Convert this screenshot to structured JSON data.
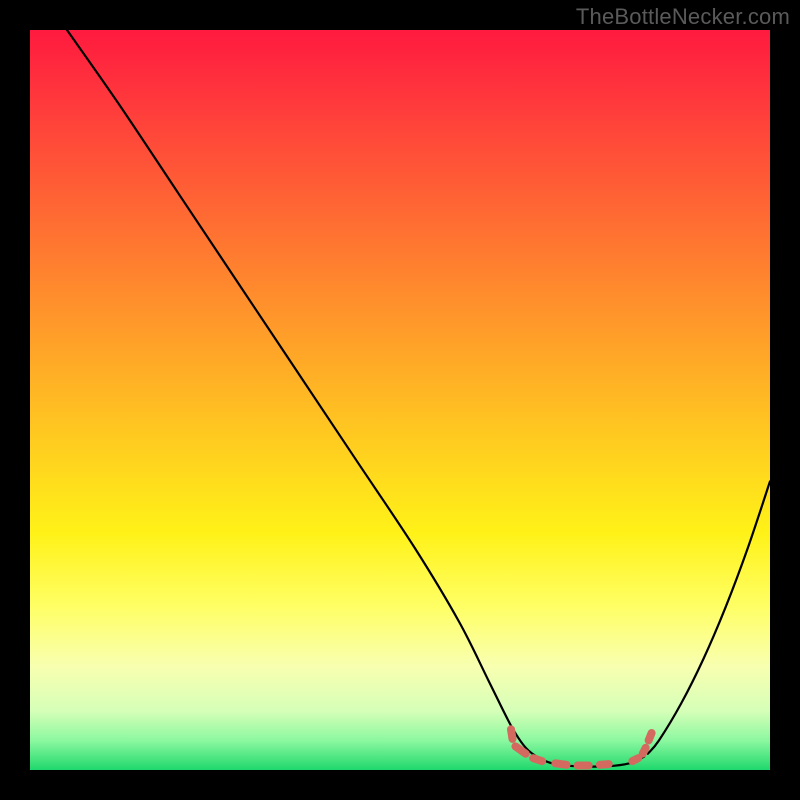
{
  "watermark": "TheBottleNecker.com",
  "chart_data": {
    "type": "line",
    "title": "",
    "xlabel": "",
    "ylabel": "",
    "xlim": [
      0,
      100
    ],
    "ylim": [
      0,
      100
    ],
    "background_gradient": {
      "stops": [
        {
          "offset": 0.0,
          "color": "#ff1a3f"
        },
        {
          "offset": 0.1,
          "color": "#ff3a3c"
        },
        {
          "offset": 0.25,
          "color": "#ff6a33"
        },
        {
          "offset": 0.4,
          "color": "#ff9a2a"
        },
        {
          "offset": 0.55,
          "color": "#ffca20"
        },
        {
          "offset": 0.68,
          "color": "#fff218"
        },
        {
          "offset": 0.78,
          "color": "#ffff66"
        },
        {
          "offset": 0.86,
          "color": "#f8ffb0"
        },
        {
          "offset": 0.92,
          "color": "#d6ffb8"
        },
        {
          "offset": 0.96,
          "color": "#8cf8a0"
        },
        {
          "offset": 1.0,
          "color": "#1fd86d"
        }
      ]
    },
    "series": [
      {
        "name": "bottleneck-curve",
        "type": "line-segments",
        "segments": [
          {
            "points": [
              [
                5,
                100
              ],
              [
                12,
                90
              ],
              [
                20,
                78
              ],
              [
                28,
                66
              ],
              [
                36,
                54
              ],
              [
                44,
                42
              ],
              [
                52,
                30
              ],
              [
                58,
                20
              ],
              [
                62,
                12
              ],
              [
                65,
                6
              ],
              [
                67,
                3
              ],
              [
                69,
                1.5
              ],
              [
                71,
                0.8
              ],
              [
                74,
                0.5
              ],
              [
                78,
                0.5
              ],
              [
                81,
                0.9
              ],
              [
                83,
                1.8
              ]
            ]
          },
          {
            "points": [
              [
                83.5,
                2.2
              ],
              [
                85,
                4
              ],
              [
                88,
                9
              ],
              [
                91,
                15
              ],
              [
                94,
                22
              ],
              [
                97,
                30
              ],
              [
                100,
                39
              ]
            ]
          }
        ]
      }
    ],
    "highlight": {
      "name": "trough-marker",
      "color": "#d46a5f",
      "points": [
        [
          65.0,
          5.5
        ],
        [
          65.2,
          4.2
        ],
        [
          65.6,
          3.2
        ],
        [
          67.0,
          2.2
        ],
        [
          68.0,
          1.6
        ],
        [
          69.2,
          1.2
        ],
        [
          71.0,
          0.9
        ],
        [
          72.5,
          0.7
        ],
        [
          74.0,
          0.6
        ],
        [
          75.5,
          0.6
        ],
        [
          77.0,
          0.7
        ],
        [
          78.2,
          0.8
        ],
        [
          81.4,
          1.2
        ],
        [
          82.2,
          1.6
        ],
        [
          82.8,
          2.2
        ],
        [
          83.2,
          3.0
        ],
        [
          83.6,
          4.0
        ],
        [
          84.0,
          5.0
        ]
      ]
    }
  }
}
